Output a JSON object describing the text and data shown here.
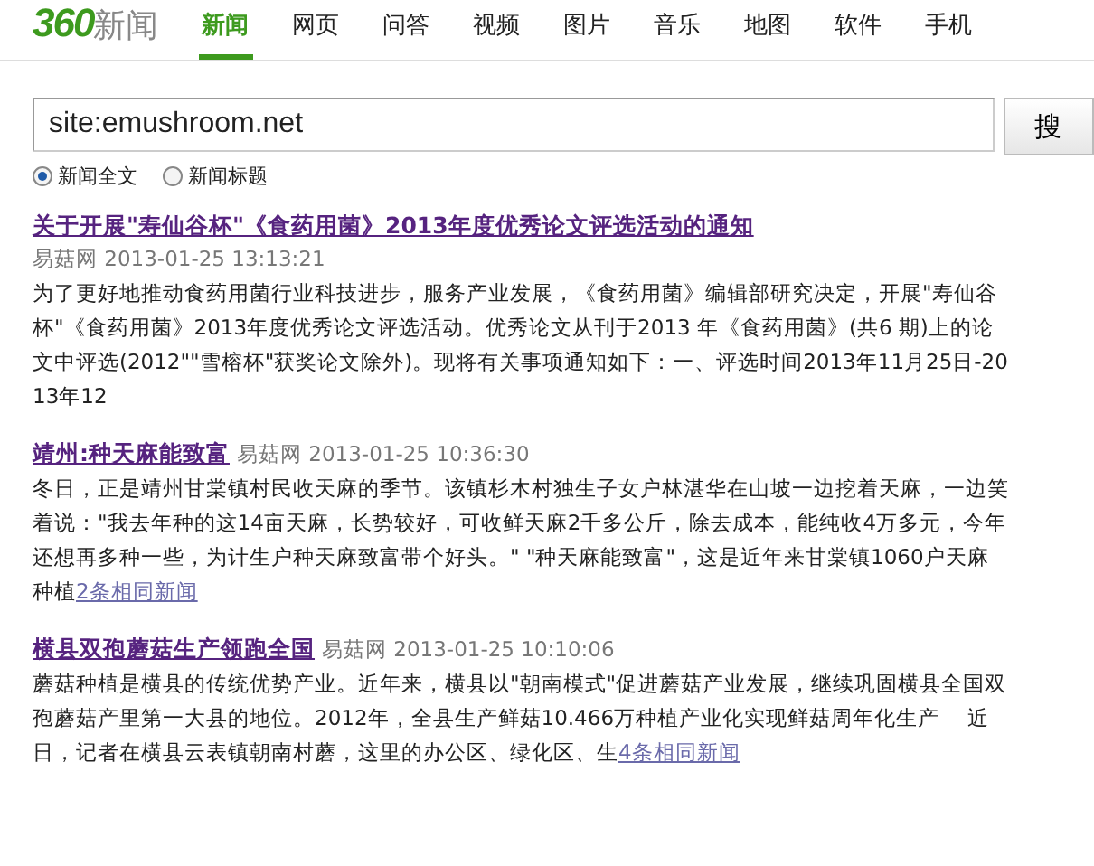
{
  "logo": {
    "number": "360",
    "word": "新闻"
  },
  "tabs": [
    {
      "label": "新闻",
      "selected": true
    },
    {
      "label": "网页",
      "selected": false
    },
    {
      "label": "问答",
      "selected": false
    },
    {
      "label": "视频",
      "selected": false
    },
    {
      "label": "图片",
      "selected": false
    },
    {
      "label": "音乐",
      "selected": false
    },
    {
      "label": "地图",
      "selected": false
    },
    {
      "label": "软件",
      "selected": false
    },
    {
      "label": "手机",
      "selected": false
    }
  ],
  "search": {
    "value": "site:emushroom.net",
    "button": "搜"
  },
  "scopes": [
    {
      "label": "新闻全文",
      "selected": true
    },
    {
      "label": "新闻标题",
      "selected": false
    }
  ],
  "results": [
    {
      "title": "关于开展\"寿仙谷杯\"《食药用菌》2013年度优秀论文评选活动的通知",
      "source": "易菇网",
      "time": "2013-01-25 13:13:21",
      "snippet": "为了更好地推动食药用菌行业科技进步，服务产业发展，《食药用菌》编辑部研究决定，开展\"寿仙谷杯\"《食药用菌》2013年度优秀论文评选活动。优秀论文从刊于2013  年《食药用菌》(共6  期)上的论文中评选(2012\"\"雪榕杯\"获奖论文除外)。现将有关事项通知如下：一、评选时间2013年11月25日-2013年12"
    },
    {
      "title": "靖州:种天麻能致富",
      "source": "易菇网",
      "time": "2013-01-25 10:36:30",
      "snippet": "冬日，正是靖州甘棠镇村民收天麻的季节。该镇杉木村独生子女户林湛华在山坡一边挖着天麻，一边笑着说：\"我去年种的这14亩天麻，长势较好，可收鲜天麻2千多公斤，除去成本，能纯收4万多元，今年还想再多种一些，为计生户种天麻致富带个好头。\"  \"种天麻能致富\"，这是近年来甘棠镇1060户天麻种植",
      "related": "2条相同新闻"
    },
    {
      "title": "横县双孢蘑菇生产领跑全国",
      "source": "易菇网",
      "time": "2013-01-25 10:10:06",
      "snippet": "蘑菇种植是横县的传统优势产业。近年来，横县以\"朝南模式\"促进蘑菇产业发展，继续巩固横县全国双孢蘑菇产里第一大县的地位。2012年，全县生产鲜菇10.466万种植产业化实现鲜菇周年化生产　 近日，记者在横县云表镇朝南村蘑，这里的办公区、绿化区、生",
      "related": "4条相同新闻"
    }
  ]
}
